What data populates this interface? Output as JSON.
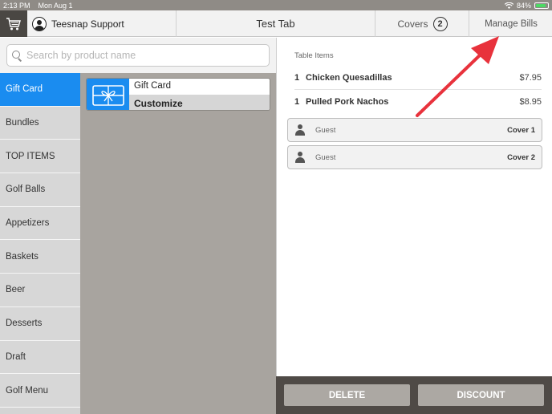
{
  "status_bar": {
    "time": "2:13 PM",
    "date": "Mon Aug 1",
    "battery": "84%",
    "battery_level": 0.84
  },
  "header": {
    "cart_icon": "shopping-cart-icon",
    "user_name": "Teesnap Support",
    "tab_title": "Test Tab",
    "covers_label": "Covers",
    "covers_count": "2",
    "manage_bills_label": "Manage Bills"
  },
  "search": {
    "placeholder": "Search by product name",
    "value": ""
  },
  "categories": [
    {
      "label": "Gift Card",
      "active": true
    },
    {
      "label": "Bundles"
    },
    {
      "label": "TOP ITEMS"
    },
    {
      "label": "Golf Balls"
    },
    {
      "label": "Appetizers"
    },
    {
      "label": "Baskets"
    },
    {
      "label": "Beer"
    },
    {
      "label": "Desserts"
    },
    {
      "label": "Draft"
    },
    {
      "label": "Golf Menu"
    }
  ],
  "products": [
    {
      "name": "Gift Card",
      "action": "Customize",
      "icon": "gift-icon"
    }
  ],
  "bill": {
    "section_label": "Table Items",
    "items": [
      {
        "qty": "1",
        "name": "Chicken Quesadillas",
        "price": "$7.95"
      },
      {
        "qty": "1",
        "name": "Pulled Pork Nachos",
        "price": "$8.95"
      }
    ],
    "guests": [
      {
        "name": "Guest",
        "cover": "Cover 1"
      },
      {
        "name": "Guest",
        "cover": "Cover 2"
      }
    ]
  },
  "actions": {
    "delete_label": "DELETE",
    "discount_label": "DISCOUNT"
  },
  "colors": {
    "accent": "#1a8cf0",
    "annotation_arrow": "#e8323c",
    "header_dark": "#4a4743",
    "product_bg": "#a8a49f"
  }
}
